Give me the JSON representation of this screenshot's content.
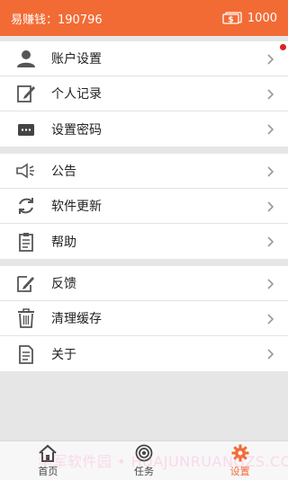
{
  "header": {
    "title": "易赚钱：190796",
    "balance": "1000",
    "bg_color": "#f26b35"
  },
  "menu": {
    "groups": [
      [
        {
          "label": "账户设置",
          "icon": "person-icon"
        },
        {
          "label": "个人记录",
          "icon": "edit-document-icon"
        },
        {
          "label": "设置密码",
          "icon": "password-card-icon"
        }
      ],
      [
        {
          "label": "公告",
          "icon": "megaphone-icon"
        },
        {
          "label": "软件更新",
          "icon": "refresh-icon"
        },
        {
          "label": "帮助",
          "icon": "clipboard-icon"
        }
      ],
      [
        {
          "label": "反馈",
          "icon": "feedback-edit-icon"
        },
        {
          "label": "清理缓存",
          "icon": "trash-icon"
        },
        {
          "label": "关于",
          "icon": "info-document-icon"
        }
      ]
    ]
  },
  "tabbar": {
    "tabs": [
      {
        "label": "首页",
        "icon": "home-icon",
        "active": false
      },
      {
        "label": "任务",
        "icon": "target-icon",
        "active": false
      },
      {
        "label": "设置",
        "icon": "gear-icon",
        "active": true
      }
    ],
    "active_color": "#f26b35"
  },
  "watermark": "华军软件园 • HUAJUNRUANGZS.COM"
}
